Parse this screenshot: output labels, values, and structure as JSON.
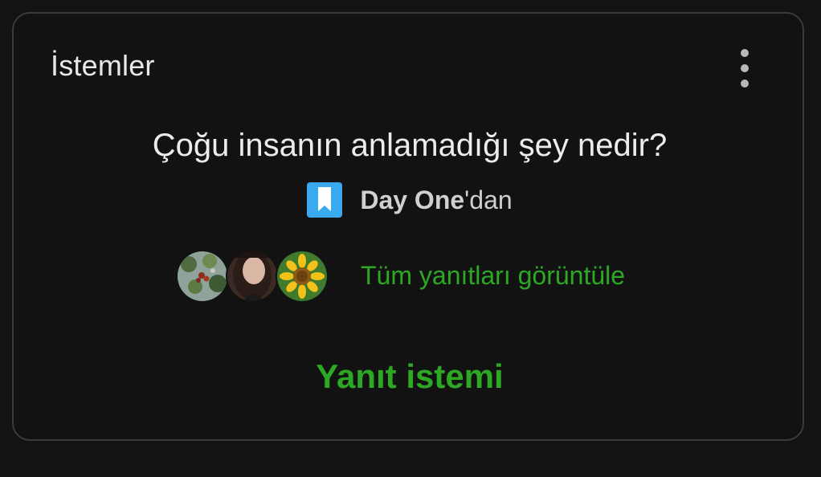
{
  "card": {
    "title": "İstemler",
    "menu_icon": "more-vertical-icon"
  },
  "prompt": {
    "question": "Çoğu insanın anlamadığı şey nedir?",
    "source_brand": "Day One",
    "source_suffix": "'dan",
    "source_icon": "bookmark-icon",
    "source_icon_color": "#39a9f0"
  },
  "responses": {
    "avatars": [
      "coffee-plant-avatar",
      "person-avatar",
      "sunflower-avatar"
    ],
    "view_all_label": "Tüm yanıtları görüntüle"
  },
  "actions": {
    "respond_label": "Yanıt istemi"
  },
  "colors": {
    "background": "#121212",
    "accent_green": "#2da825",
    "text_primary": "#ececec",
    "border": "#3a3a3a"
  }
}
